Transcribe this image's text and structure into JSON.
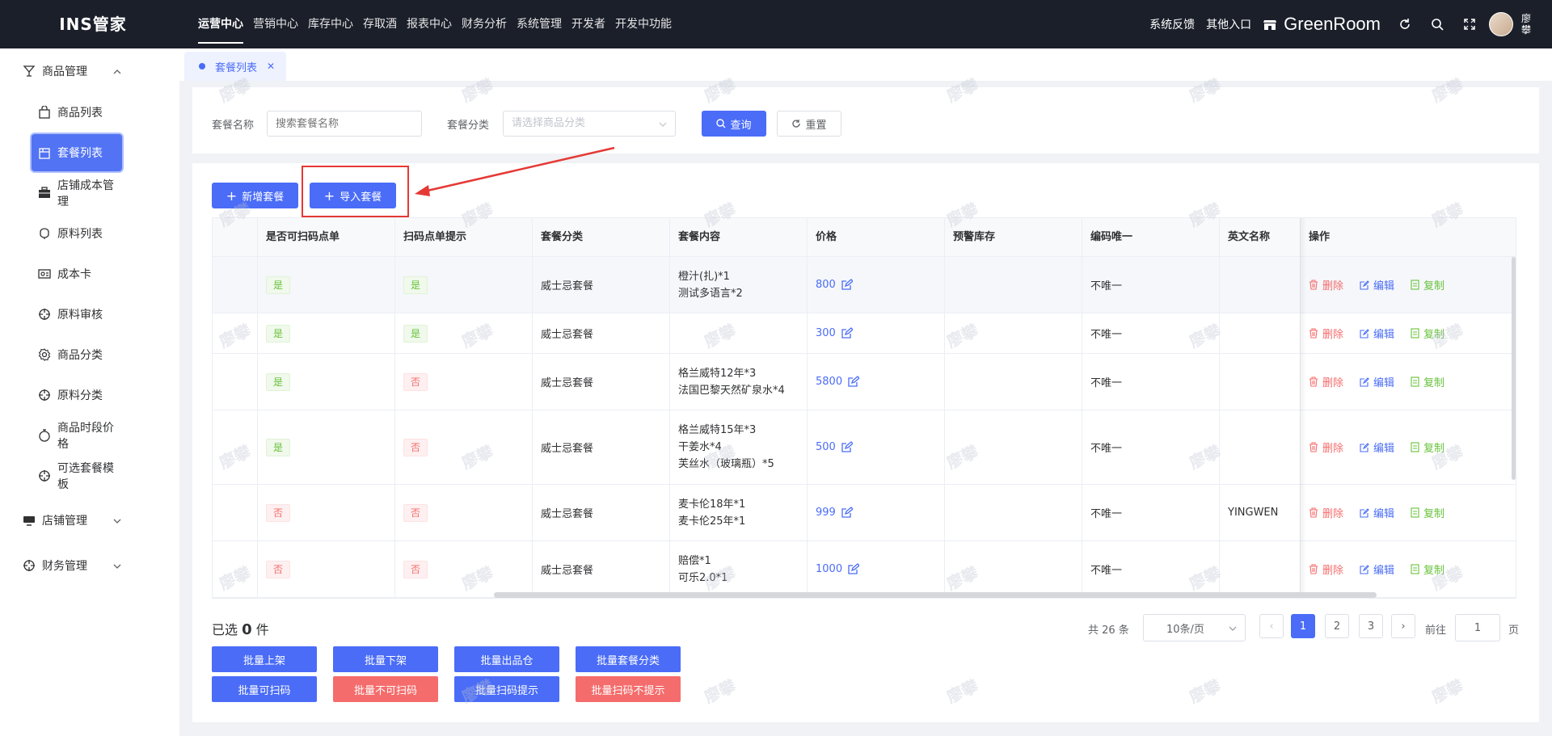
{
  "app": {
    "logo": "INS管家"
  },
  "topnav": [
    "运营中心",
    "营销中心",
    "库存中心",
    "存取酒",
    "报表中心",
    "财务分析",
    "系统管理",
    "开发者",
    "开发中功能"
  ],
  "topright": {
    "feedback": "系统反馈",
    "other_entry": "其他入口",
    "store": "GreenRoom",
    "user": "廖攀"
  },
  "sidebar": {
    "group_goods": "商品管理",
    "items": [
      {
        "label": "商品列表",
        "icon": "bag-icon"
      },
      {
        "label": "套餐列表",
        "icon": "package-icon"
      },
      {
        "label": "店铺成本管理",
        "icon": "briefcase-icon"
      },
      {
        "label": "原料列表",
        "icon": "ingredient-icon"
      },
      {
        "label": "成本卡",
        "icon": "card-icon"
      },
      {
        "label": "原料审核",
        "icon": "crosshair-icon"
      },
      {
        "label": "商品分类",
        "icon": "gear-icon"
      },
      {
        "label": "原料分类",
        "icon": "crosshair-icon"
      },
      {
        "label": "商品时段价格",
        "icon": "clock-icon"
      },
      {
        "label": "可选套餐模板",
        "icon": "crosshair-icon"
      }
    ],
    "group_store": "店铺管理",
    "group_finance": "财务管理"
  },
  "tab": {
    "label": "套餐列表"
  },
  "search": {
    "name_label": "套餐名称",
    "name_placeholder": "搜索套餐名称",
    "category_label": "套餐分类",
    "category_placeholder": "请选择商品分类",
    "query": "查询",
    "reset": "重置"
  },
  "toolbar": {
    "add": "新增套餐",
    "import": "导入套餐"
  },
  "table": {
    "columns": [
      "是否可扫码点单",
      "扫码点单提示",
      "套餐分类",
      "套餐内容",
      "价格",
      "预警库存",
      "编码唯一",
      "英文名称",
      "操作"
    ],
    "actions": {
      "delete": "删除",
      "edit": "编辑",
      "copy": "复制"
    },
    "rows": [
      {
        "scan": "是",
        "hint": "是",
        "category": "威士忌套餐",
        "content": [
          "橙汁(扎)*1",
          "测试多语言*2"
        ],
        "price": "800",
        "stock": "",
        "unique": "不唯一",
        "en": ""
      },
      {
        "scan": "是",
        "hint": "是",
        "category": "威士忌套餐",
        "content": [],
        "price": "300",
        "stock": "",
        "unique": "不唯一",
        "en": ""
      },
      {
        "scan": "是",
        "hint": "否",
        "category": "威士忌套餐",
        "content": [
          "格兰威特12年*3",
          "法国巴黎天然矿泉水*4"
        ],
        "price": "5800",
        "stock": "",
        "unique": "不唯一",
        "en": ""
      },
      {
        "scan": "是",
        "hint": "否",
        "category": "威士忌套餐",
        "content": [
          "格兰威特15年*3",
          "干姜水*4",
          "芙丝水（玻璃瓶）*5"
        ],
        "price": "500",
        "stock": "",
        "unique": "不唯一",
        "en": ""
      },
      {
        "scan": "否",
        "hint": "否",
        "category": "威士忌套餐",
        "content": [
          "麦卡伦18年*1",
          "麦卡伦25年*1"
        ],
        "price": "999",
        "stock": "",
        "unique": "不唯一",
        "en": "YINGWEN"
      },
      {
        "scan": "否",
        "hint": "否",
        "category": "威士忌套餐",
        "content": [
          "赔偿*1",
          "可乐2.0*1"
        ],
        "price": "1000",
        "stock": "",
        "unique": "不唯一",
        "en": ""
      }
    ]
  },
  "footer": {
    "selected_prefix": "已选",
    "selected_count": "0",
    "selected_suffix": "件",
    "batch": [
      {
        "label": "批量上架",
        "color": "blue"
      },
      {
        "label": "批量下架",
        "color": "blue"
      },
      {
        "label": "批量出品仓",
        "color": "blue"
      },
      {
        "label": "批量套餐分类",
        "color": "blue"
      },
      {
        "label": "批量可扫码",
        "color": "blue"
      },
      {
        "label": "批量不可扫码",
        "color": "red"
      },
      {
        "label": "批量扫码提示",
        "color": "blue"
      },
      {
        "label": "批量扫码不提示",
        "color": "red"
      }
    ]
  },
  "pagination": {
    "total": "共 26 条",
    "page_size": "10条/页",
    "pages": [
      "1",
      "2",
      "3"
    ],
    "current": "1",
    "goto_label": "前往",
    "goto_value": "1",
    "page_unit": "页"
  },
  "watermark": "廖攀",
  "colors": {
    "primary": "#4a6cf7",
    "danger": "#f56c6c",
    "success": "#67c23a",
    "topbar": "#1b1f2a"
  }
}
